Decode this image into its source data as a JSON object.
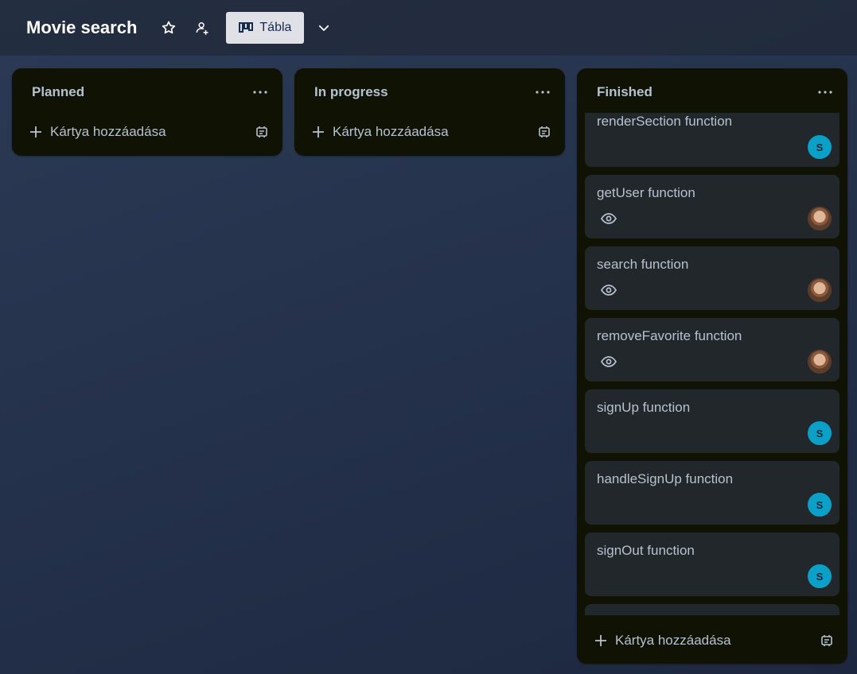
{
  "header": {
    "title": "Movie search",
    "view_label": "Tábla",
    "icons": [
      "star-icon",
      "workspace-visibility-icon",
      "board-view-icon",
      "chevron-down-icon"
    ]
  },
  "lists": [
    {
      "title": "Planned",
      "add_card_label": "Kártya hozzáadása"
    },
    {
      "title": "In progress",
      "add_card_label": "Kártya hozzáadása"
    },
    {
      "title": "Finished",
      "add_card_label": "Kártya hozzáadása",
      "cards": [
        {
          "title": "renderSection function",
          "watching": false,
          "member": "S"
        },
        {
          "title": "getUser function",
          "watching": true,
          "member": "photo"
        },
        {
          "title": "search function",
          "watching": true,
          "member": "photo"
        },
        {
          "title": "removeFavorite function",
          "watching": true,
          "member": "photo"
        },
        {
          "title": "signUp function",
          "watching": false,
          "member": "S"
        },
        {
          "title": "handleSignUp function",
          "watching": false,
          "member": "S"
        },
        {
          "title": "signOut function",
          "watching": false,
          "member": "S"
        },
        {
          "title": "",
          "watching": false,
          "member": ""
        }
      ]
    }
  ],
  "colors": {
    "list_bg": "#101204",
    "card_bg": "#22272b",
    "text": "#b6c2cf",
    "avatar_s": "#0aa0c8",
    "view_button_bg": "#dfe1e6"
  }
}
